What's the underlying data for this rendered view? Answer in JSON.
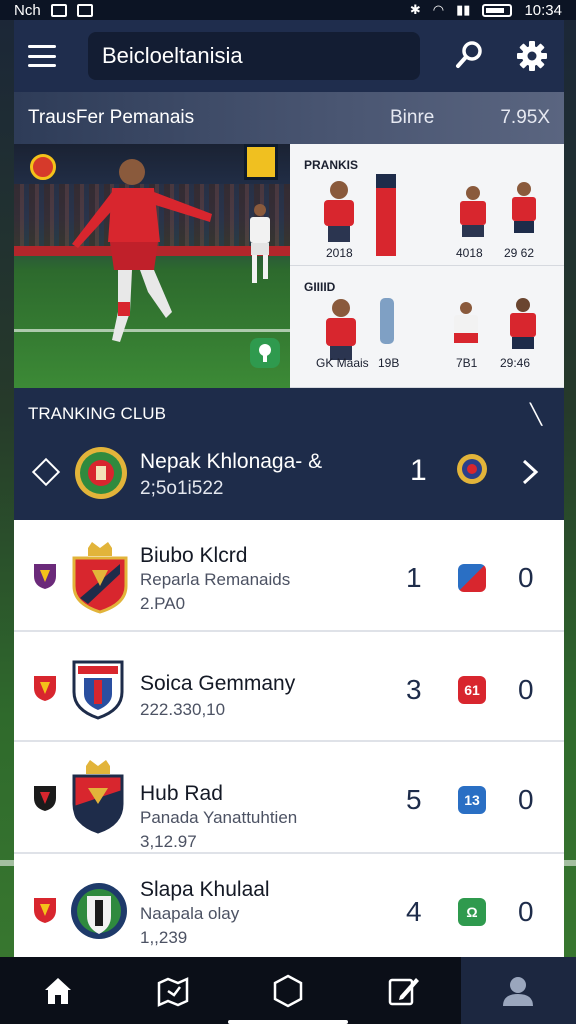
{
  "status_bar": {
    "carrier": "Nch",
    "time": "10:34"
  },
  "header": {
    "search_text": "Beicloeltanisia"
  },
  "transfer_bar": {
    "title": "TrausFer Pemanais",
    "middle": "Binre",
    "right": "7.95X"
  },
  "hero_panel": {
    "section1": {
      "label": "PRANKIS",
      "captions": [
        "2018",
        "4018",
        "29 62"
      ]
    },
    "section2": {
      "label": "GIIIID",
      "captions": [
        "GK Maais",
        "19B",
        "7B1",
        "29:46"
      ]
    }
  },
  "ranking": {
    "title": "TRANKING CLUB",
    "featured": {
      "name": "Nepak Khlonaga- &",
      "subtitle": "2;5o1i522",
      "rank": "1"
    }
  },
  "clubs": [
    {
      "name": "Biubo Klcrd",
      "subtitle": "Reparla Remanaids",
      "value": "2.PA0",
      "position": "1",
      "badge": "",
      "points": "0"
    },
    {
      "name": "Soica Gemmany",
      "subtitle": "222.330,10",
      "value": "",
      "position": "3",
      "badge": "61",
      "points": "0"
    },
    {
      "name": "Hub Rad",
      "subtitle": "Panada Yanattuhtien",
      "value": "3,12.97",
      "position": "5",
      "badge": "13",
      "points": "0"
    },
    {
      "name": "Slapa Khulaal",
      "subtitle": "Naapala olay",
      "value": "1,,239",
      "position": "4",
      "badge": "Ω",
      "points": "0"
    }
  ],
  "colors": {
    "navy": "#1e2c4a",
    "accent_red": "#d8262e",
    "badge_blue": "#2a6fc4",
    "badge_green": "#2f9a4e"
  },
  "icons": [
    "menu-icon",
    "search-icon",
    "gear-icon",
    "home-icon",
    "map-icon",
    "hexagon-icon",
    "edit-icon",
    "profile-icon"
  ]
}
